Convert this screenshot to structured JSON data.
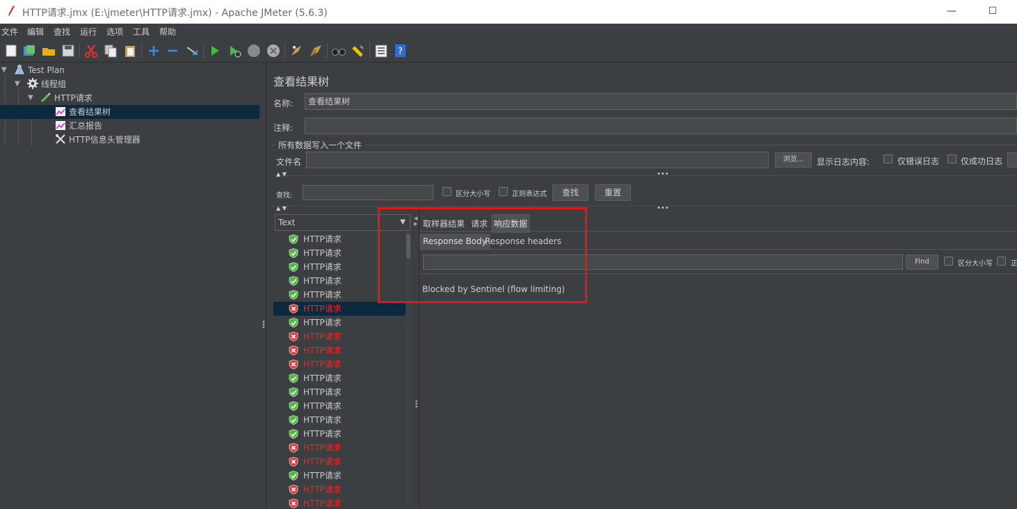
{
  "window": {
    "title": "HTTP请求.jmx (E:\\jmeter\\HTTP请求.jmx) - Apache JMeter (5.6.3)",
    "minimize_glyph": "—",
    "maximize_glyph": "☐"
  },
  "menu": [
    "文件",
    "编辑",
    "查找",
    "运行",
    "选项",
    "工具",
    "帮助"
  ],
  "toolbar": [
    "new-icon",
    "templates-icon",
    "open-icon",
    "save-icon",
    "cut-icon",
    "copy-icon",
    "paste-icon",
    "expand-icon",
    "collapse-icon",
    "toggle-icon",
    "start-icon",
    "start-no-pause-icon",
    "stop-icon",
    "shutdown-icon",
    "clear-icon",
    "clear-all-icon",
    "search-icon",
    "reset-search-icon",
    "function-helper-icon",
    "help-icon"
  ],
  "tree": {
    "items": [
      {
        "label": "Test Plan",
        "icon": "test-plan-icon"
      },
      {
        "label": "线程组",
        "icon": "gear-icon"
      },
      {
        "label": "HTTP请求",
        "icon": "pipette-icon"
      },
      {
        "label": "查看结果树",
        "icon": "graph-icon",
        "selected": true
      },
      {
        "label": "汇总报告",
        "icon": "graph-icon"
      },
      {
        "label": "HTTP信息头管理器",
        "icon": "wrench-icon"
      }
    ]
  },
  "panel": {
    "title": "查看结果树",
    "name_label": "名称:",
    "name_value": "查看结果树",
    "comment_label": "注释:",
    "comment_value": "",
    "file_section": "所有数据写入一个文件",
    "filename_label": "文件名",
    "filename_value": "",
    "browse_button": "浏览...",
    "log_label": "显示日志内容:",
    "errors_only": "仅错误日志",
    "success_only": "仅成功日志",
    "search_label": "查找:",
    "search_value": "",
    "case_sensitive": "区分大小写",
    "regex": "正则表达式",
    "find_button": "查找",
    "reset_button": "重置",
    "renderer_value": "Text"
  },
  "results": [
    {
      "label": "HTTP请求",
      "status": "ok"
    },
    {
      "label": "HTTP请求",
      "status": "ok"
    },
    {
      "label": "HTTP请求",
      "status": "ok"
    },
    {
      "label": "HTTP请求",
      "status": "ok"
    },
    {
      "label": "HTTP请求",
      "status": "ok"
    },
    {
      "label": "HTTP请求",
      "status": "err",
      "selected": true
    },
    {
      "label": "HTTP请求",
      "status": "ok"
    },
    {
      "label": "HTTP请求",
      "status": "err"
    },
    {
      "label": "HTTP请求",
      "status": "err"
    },
    {
      "label": "HTTP请求",
      "status": "err"
    },
    {
      "label": "HTTP请求",
      "status": "ok"
    },
    {
      "label": "HTTP请求",
      "status": "ok"
    },
    {
      "label": "HTTP请求",
      "status": "ok"
    },
    {
      "label": "HTTP请求",
      "status": "ok"
    },
    {
      "label": "HTTP请求",
      "status": "ok"
    },
    {
      "label": "HTTP请求",
      "status": "err"
    },
    {
      "label": "HTTP请求",
      "status": "err"
    },
    {
      "label": "HTTP请求",
      "status": "ok"
    },
    {
      "label": "HTTP请求",
      "status": "err"
    },
    {
      "label": "HTTP请求",
      "status": "err"
    }
  ],
  "detail": {
    "tabs": [
      "取样器结果",
      "请求",
      "响应数据"
    ],
    "active_tab": 2,
    "subtabs": [
      "Response Body",
      "Response headers"
    ],
    "active_subtab": 0,
    "find_value": "",
    "find_button": "Find",
    "case_sensitive": "区分大小写",
    "regex_cut": "正",
    "body_text": "Blocked by Sentinel (flow limiting)"
  },
  "colors": {
    "ok": "#4fb83e",
    "err": "#e53935",
    "highlight_box": "#e8161b",
    "selection": "#0d293e"
  }
}
